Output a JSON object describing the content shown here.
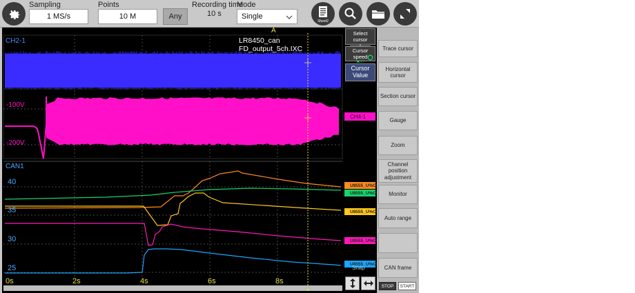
{
  "toolbar": {
    "sampling_label": "Sampling",
    "sampling_value": "1 MS/s",
    "points_label": "Points",
    "points_value": "10 M",
    "any_button": "Any",
    "recording_time_label": "Recording time",
    "recording_time_value": "10 s",
    "mode_label": "Mode",
    "mode_value": "Single",
    "sheet_label": "Sheet2"
  },
  "icons": {
    "settings": "gear-icon",
    "sheet": "sheet-icon",
    "search": "magnifier-icon",
    "folder": "folder-icon",
    "fullscreen": "expand-icon"
  },
  "display": {
    "filename": "LR8450_can FD_output_5ch.IXC",
    "cursor_a_label": "A",
    "pane1_channel": "CH2-1",
    "pane2_labels": [
      "-100V",
      "-200V"
    ],
    "pane3_channel": "CAN1",
    "pane3_yticks": [
      "40",
      "35",
      "30",
      "25"
    ],
    "xticks": [
      "0s",
      "2s",
      "4s",
      "6s",
      "8s"
    ],
    "ch4_marker": "CH4-1"
  },
  "middle": {
    "select_cursor_label": "Select cursor",
    "select_cursor_value": "A",
    "cursor_speed_label": "Cursor speed",
    "cursor_speed_value": "■□□",
    "cursor_value_button": "Cursor Value",
    "snap_label": "Snap",
    "markers": [
      "U8555_U%CH07",
      "U8555_U%CH06",
      "U8555_U%CH03",
      "U8555_U%CH04",
      "U8555_U%CH05"
    ]
  },
  "right_menu": [
    "Trace cursor",
    "Horizontal cursor",
    "Section cursor",
    "Gauge",
    "Zoom",
    "Channel position adjustment",
    "Monitor",
    "Auto range",
    "",
    "CAN frame"
  ],
  "stop_label": "STOP",
  "start_label": "START",
  "colors": {
    "ch2": "#3a2cff",
    "ch4": "#ff10c8",
    "orange": "#ff8a1e",
    "green": "#16d46a",
    "yellow": "#ffc81a",
    "magenta": "#ff18b8",
    "blue": "#1aa6ff"
  }
}
